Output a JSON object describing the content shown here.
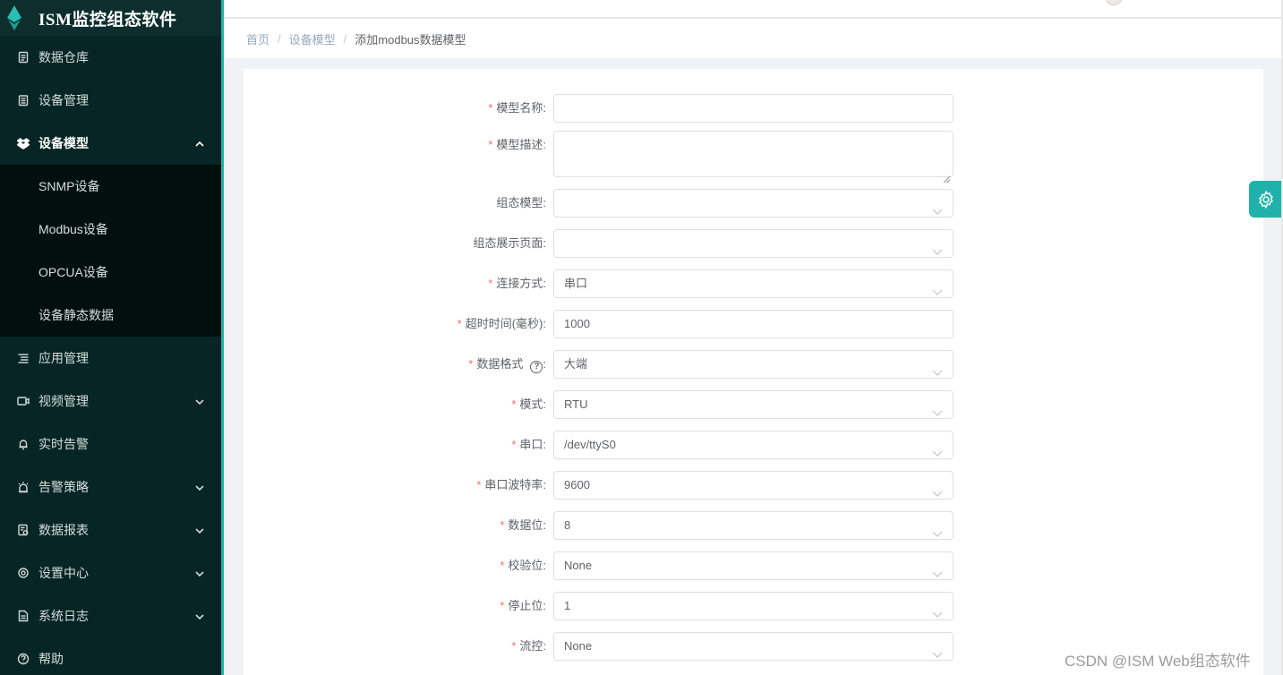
{
  "app": {
    "title": "ISM监控组态软件"
  },
  "sidebar": {
    "items": [
      {
        "label": "数据仓库",
        "icon": "document-icon",
        "expandable": false
      },
      {
        "label": "设备管理",
        "icon": "clipboard-icon",
        "expandable": false
      },
      {
        "label": "设备模型",
        "icon": "dropbox-icon",
        "expandable": true,
        "expanded": true,
        "active": true
      },
      {
        "label": "应用管理",
        "icon": "list-icon",
        "expandable": false
      },
      {
        "label": "视频管理",
        "icon": "video-icon",
        "expandable": true
      },
      {
        "label": "实时告警",
        "icon": "bell-icon",
        "expandable": false
      },
      {
        "label": "告警策略",
        "icon": "alarm-icon",
        "expandable": true
      },
      {
        "label": "数据报表",
        "icon": "report-icon",
        "expandable": true
      },
      {
        "label": "设置中心",
        "icon": "gear-icon",
        "expandable": true
      },
      {
        "label": "系统日志",
        "icon": "log-icon",
        "expandable": true
      },
      {
        "label": "帮助",
        "icon": "help-circle-icon",
        "expandable": false
      }
    ],
    "submenu": [
      "SNMP设备",
      "Modbus设备",
      "OPCUA设备",
      "设备静态数据"
    ]
  },
  "breadcrumb": [
    "首页",
    "设备模型",
    "添加modbus数据模型"
  ],
  "form": {
    "fields": [
      {
        "label": "模型名称:",
        "required": true,
        "type": "input",
        "value": ""
      },
      {
        "label": "模型描述:",
        "required": true,
        "type": "textarea",
        "value": ""
      },
      {
        "label": "组态模型:",
        "required": false,
        "type": "select",
        "value": ""
      },
      {
        "label": "组态展示页面:",
        "required": false,
        "type": "select",
        "value": ""
      },
      {
        "label": "连接方式:",
        "required": true,
        "type": "select",
        "value": "串口"
      },
      {
        "label": "超时时间(毫秒):",
        "required": true,
        "type": "input",
        "value": "1000"
      },
      {
        "label": "数据格式",
        "required": true,
        "type": "select",
        "value": "大端",
        "help": true,
        "help_glyph": "?"
      },
      {
        "label": "模式:",
        "required": true,
        "type": "select",
        "value": "RTU"
      },
      {
        "label": "串口:",
        "required": true,
        "type": "select",
        "value": "/dev/ttyS0"
      },
      {
        "label": "串口波特率:",
        "required": true,
        "type": "select",
        "value": "9600"
      },
      {
        "label": "数据位:",
        "required": true,
        "type": "select",
        "value": "8"
      },
      {
        "label": "校验位:",
        "required": true,
        "type": "select",
        "value": "None"
      },
      {
        "label": "停止位:",
        "required": true,
        "type": "select",
        "value": "1"
      },
      {
        "label": "流控:",
        "required": true,
        "type": "select",
        "value": "None"
      }
    ],
    "required_mark": "*",
    "help_colon": ":"
  },
  "watermark": "CSDN @ISM Web组态软件",
  "colors": {
    "sidebar_bg": "#062524",
    "submenu_bg": "#010f0e",
    "accent": "#20b2aa",
    "required": "#f56c6c"
  }
}
